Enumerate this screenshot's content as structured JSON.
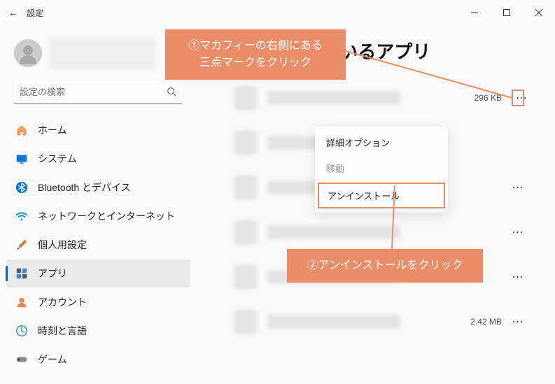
{
  "window": {
    "title": "設定",
    "page_title": "トールされているアプリ"
  },
  "search": {
    "placeholder": "設定の検索"
  },
  "nav": [
    {
      "label": "ホーム"
    },
    {
      "label": "システム"
    },
    {
      "label": "Bluetooth とデバイス"
    },
    {
      "label": "ネットワークとインターネット"
    },
    {
      "label": "個人用設定"
    },
    {
      "label": "アプリ"
    },
    {
      "label": "アカウント"
    },
    {
      "label": "時刻と言語"
    },
    {
      "label": "ゲーム"
    }
  ],
  "apps": {
    "row0_size": "296 KB",
    "row5_size": "2.42 MB"
  },
  "context_menu": {
    "advanced": "詳細オプション",
    "move": "移動",
    "uninstall": "アンインストール"
  },
  "callouts": {
    "c1_line1": "①マカフィーの右側にある",
    "c1_line2": "三点マークをクリック",
    "c2": "②アンインストールをクリック"
  },
  "colors": {
    "accent": "#ea8e6a"
  }
}
